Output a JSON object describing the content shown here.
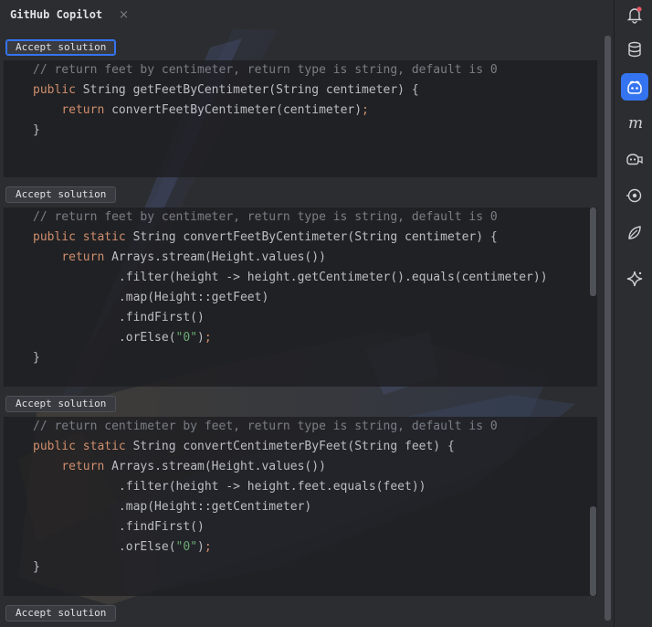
{
  "header": {
    "title": "GitHub Copilot",
    "close_glyph": "×"
  },
  "accept_label": "Accept solution",
  "solutions": [
    {
      "lines": [
        [
          {
            "t": "// return feet by centimeter, return type is string, default is 0",
            "k": "cm"
          }
        ],
        [
          {
            "t": "public ",
            "k": "kw"
          },
          {
            "t": "String getFeetByCentimeter(String centimeter) {",
            "k": "plain"
          }
        ],
        [
          {
            "t": "    ",
            "k": "plain"
          },
          {
            "t": "return ",
            "k": "kw"
          },
          {
            "t": "convertFeetByCentimeter(centimeter)",
            "k": "plain"
          },
          {
            "t": ";",
            "k": "kw"
          }
        ],
        [
          {
            "t": "}",
            "k": "plain"
          }
        ]
      ]
    },
    {
      "lines": [
        [
          {
            "t": "// return feet by centimeter, return type is string, default is 0",
            "k": "cm"
          }
        ],
        [
          {
            "t": "public static ",
            "k": "kw"
          },
          {
            "t": "String convertFeetByCentimeter(String centimeter) {",
            "k": "plain"
          }
        ],
        [
          {
            "t": "    ",
            "k": "plain"
          },
          {
            "t": "return ",
            "k": "kw"
          },
          {
            "t": "Arrays.stream(Height.values())",
            "k": "plain"
          }
        ],
        [
          {
            "t": "            .filter(height -> height.getCentimeter().equals(centimeter))",
            "k": "plain"
          }
        ],
        [
          {
            "t": "            .map(Height::getFeet)",
            "k": "plain"
          }
        ],
        [
          {
            "t": "            .findFirst()",
            "k": "plain"
          }
        ],
        [
          {
            "t": "            .orElse(",
            "k": "plain"
          },
          {
            "t": "\"0\"",
            "k": "str"
          },
          {
            "t": ")",
            "k": "plain"
          },
          {
            "t": ";",
            "k": "kw"
          }
        ],
        [
          {
            "t": "}",
            "k": "plain"
          }
        ]
      ]
    },
    {
      "lines": [
        [
          {
            "t": "// return centimeter by feet, return type is string, default is 0",
            "k": "cm"
          }
        ],
        [
          {
            "t": "public static ",
            "k": "kw"
          },
          {
            "t": "String convertCentimeterByFeet(String feet) {",
            "k": "plain"
          }
        ],
        [
          {
            "t": "    ",
            "k": "plain"
          },
          {
            "t": "return ",
            "k": "kw"
          },
          {
            "t": "Arrays.stream(Height.values())",
            "k": "plain"
          }
        ],
        [
          {
            "t": "            .filter(height -> height.feet.equals(feet))",
            "k": "plain"
          }
        ],
        [
          {
            "t": "            .map(Height::getCentimeter)",
            "k": "plain"
          }
        ],
        [
          {
            "t": "            .findFirst()",
            "k": "plain"
          }
        ],
        [
          {
            "t": "            .orElse(",
            "k": "plain"
          },
          {
            "t": "\"0\"",
            "k": "str"
          },
          {
            "t": ")",
            "k": "plain"
          },
          {
            "t": ";",
            "k": "kw"
          }
        ],
        [
          {
            "t": "}",
            "k": "plain"
          }
        ]
      ]
    }
  ],
  "toolbar": {
    "tools": [
      {
        "name": "notifications-icon",
        "active": false
      },
      {
        "name": "database-icon",
        "active": false
      },
      {
        "name": "copilot-icon",
        "active": true
      },
      {
        "name": "maven-icon",
        "active": false
      },
      {
        "name": "copilot-chat-icon",
        "active": false
      },
      {
        "name": "endpoints-icon",
        "active": false
      },
      {
        "name": "spring-leaf-icon",
        "active": false
      },
      {
        "name": "ai-assistant-icon",
        "active": false
      }
    ]
  },
  "colors": {
    "accent": "#3574f0",
    "keyword": "#cf8e6d",
    "comment": "#7a7e85",
    "string": "#6aab73",
    "text": "#bcbec4"
  }
}
